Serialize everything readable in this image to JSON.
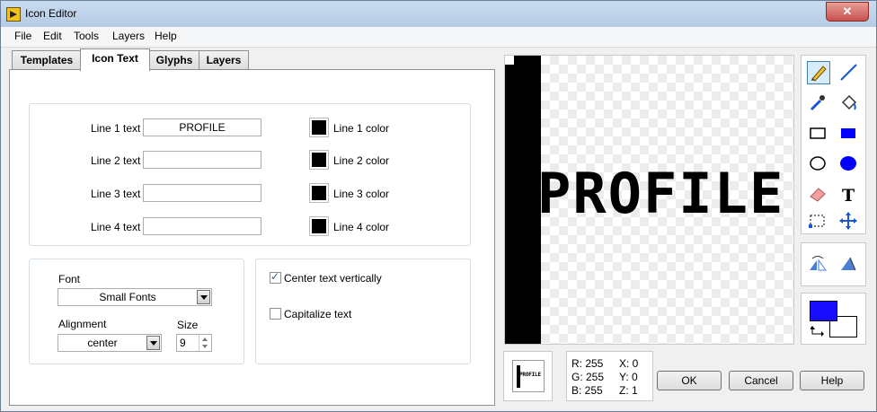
{
  "window": {
    "title": "Icon Editor",
    "close_label": "✕"
  },
  "menu": [
    "File",
    "Edit",
    "Tools",
    "Layers",
    "Help"
  ],
  "tabs": [
    "Templates",
    "Icon Text",
    "Glyphs",
    "Layers"
  ],
  "active_tab": "Icon Text",
  "lines": [
    {
      "label": "Line 1 text",
      "value": "PROFILE",
      "color_label": "Line 1 color",
      "color": "#000000"
    },
    {
      "label": "Line 2 text",
      "value": "",
      "color_label": "Line 2 color",
      "color": "#000000"
    },
    {
      "label": "Line 3 text",
      "value": "",
      "color_label": "Line 3 color",
      "color": "#000000"
    },
    {
      "label": "Line 4 text",
      "value": "",
      "color_label": "Line 4 color",
      "color": "#000000"
    }
  ],
  "font": {
    "label": "Font",
    "value": "Small Fonts"
  },
  "alignment": {
    "label": "Alignment",
    "value": "center"
  },
  "size": {
    "label": "Size",
    "value": "9"
  },
  "options": {
    "center_vertically": {
      "label": "Center text vertically",
      "checked": true
    },
    "capitalize": {
      "label": "Capitalize text",
      "checked": false
    }
  },
  "canvas": {
    "text": "PROFILE",
    "preview_text": "PROFILE"
  },
  "tools": [
    "pencil-icon",
    "line-icon",
    "dropper-icon",
    "fill-icon",
    "rectangle-icon",
    "filled-rectangle-icon",
    "ellipse-icon",
    "filled-ellipse-icon",
    "eraser-icon",
    "text-icon",
    "select-icon",
    "move-icon"
  ],
  "selected_tool": "pencil-icon",
  "colors": {
    "foreground": "#1a0dff",
    "background": "#ffffff"
  },
  "info": {
    "r": "R: 255",
    "g": "G: 255",
    "b": "B: 255",
    "x": "X: 0",
    "y": "Y: 0",
    "z": "Z: 1"
  },
  "buttons": {
    "ok": "OK",
    "cancel": "Cancel",
    "help": "Help"
  }
}
